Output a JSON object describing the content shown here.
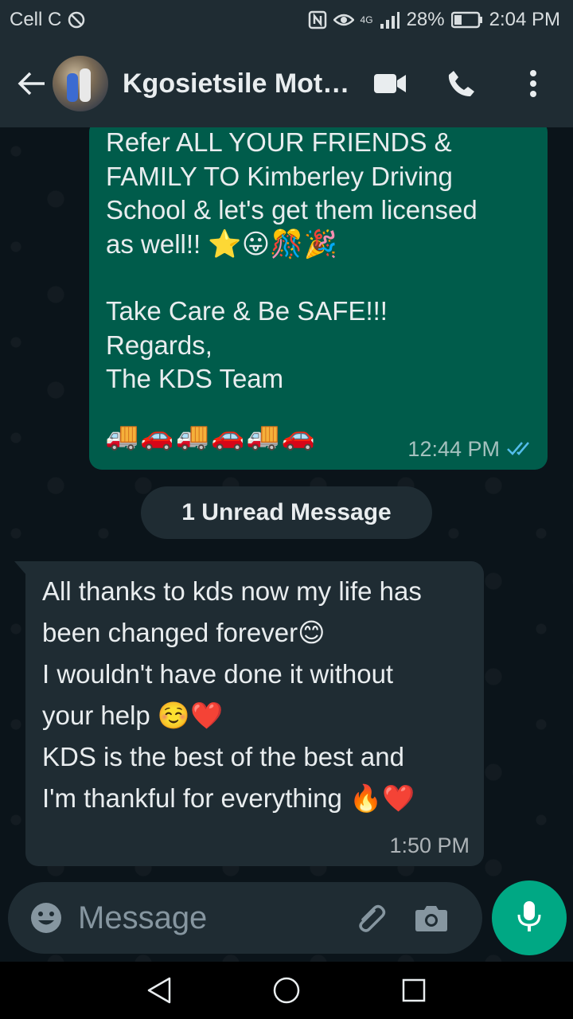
{
  "status_bar": {
    "carrier": "Cell C",
    "network": "4G",
    "battery": "28%",
    "time": "2:04 PM"
  },
  "header": {
    "contact_name": "Kgosietsile Moth…",
    "icons": [
      "back-arrow-icon",
      "video-call-icon",
      "voice-call-icon",
      "more-options-icon"
    ]
  },
  "messages": {
    "outgoing": {
      "text": "Refer ALL YOUR FRIENDS &\nFAMILY TO Kimberley Driving\nSchool & let's get them licensed\nas well!! ",
      "emojis": "⭐😛🎊🎉",
      "closing": "Take Care & Be SAFE!!!\nRegards,\nThe KDS Team",
      "vehicles": "🚚🚗🚚🚗🚚🚗",
      "time": "12:44 PM",
      "status": "read"
    },
    "unread_divider": "1 Unread Message",
    "incoming": {
      "lines": [
        "All thanks to kds now my life has",
        "been changed forever😊",
        "I wouldn't have done it without",
        "your help ☺️❤️",
        "KDS is the best of the best and",
        "I'm thankful for everything 🔥❤️"
      ],
      "time": "1:50 PM"
    }
  },
  "composer": {
    "placeholder": "Message"
  },
  "colors": {
    "header_bg": "#1f2c33",
    "chat_bg": "#0b141a",
    "outgoing_bubble": "#005c4b",
    "incoming_bubble": "#1f2c33",
    "accent": "#00a884",
    "read_ticks": "#53bdeb"
  }
}
